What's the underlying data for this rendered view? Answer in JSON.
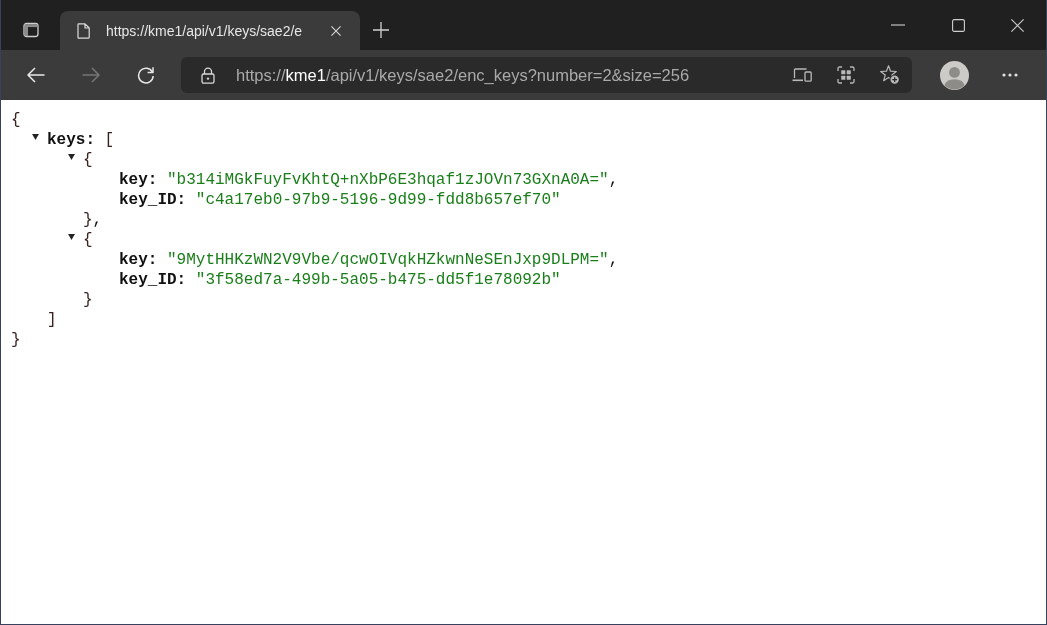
{
  "tab_strip": {
    "tabs": [
      {
        "title": "https://kme1/api/v1/keys/sae2/e",
        "selected": true
      }
    ]
  },
  "toolbar": {
    "nav_buttons": [
      {
        "kind": "back",
        "disabled": false
      },
      {
        "kind": "forward",
        "disabled": true
      },
      {
        "kind": "refresh",
        "disabled": false
      }
    ],
    "address_bar": {
      "scheme": "https://",
      "host": "kme1",
      "path": "/api/v1/keys/sae2/enc_keys?number=2&size=256"
    }
  },
  "json_view": {
    "open": "{",
    "close": "}",
    "children": [
      {
        "name": "keys:",
        "open": "[",
        "close": "]",
        "expanded": true,
        "children": [
          {
            "open": "{",
            "close": "}",
            "comma": ",",
            "expanded": true,
            "children": [
              {
                "name": "key:",
                "value": "\"b314iMGkFuyFvKhtQ+nXbP6E3hqaf1zJOVn73GXnA0A=\"",
                "comma": ","
              },
              {
                "name": "key_ID:",
                "value": "\"c4a17eb0-97b9-5196-9d99-fdd8b657ef70\""
              }
            ]
          },
          {
            "open": "{",
            "close": "}",
            "expanded": true,
            "children": [
              {
                "name": "key:",
                "value": "\"9MytHHKzWN2V9Vbe/qcwOIVqkHZkwnNeSEnJxp9DLPM=\"",
                "comma": ","
              },
              {
                "name": "key_ID:",
                "value": "\"3f58ed7a-499b-5a05-b475-dd5f1e78092b\""
              }
            ]
          }
        ]
      }
    ]
  }
}
